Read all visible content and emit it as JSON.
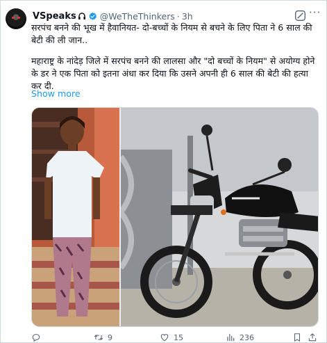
{
  "tweet": {
    "display_name": "VSpeaks",
    "handle": "@WeTheThinkers",
    "separator": "·",
    "time": "3h",
    "text_line1": "सरपंच बनने की भूख में हैवानियत- दो-बच्चों के नियम से बचने के लिए पिता ने 6 साल की बेटी की ली जान..",
    "text_line2": "महाराष्ट्र के नांदेड़ जिले में सरपंच बनने की लालसा और \"दो बच्चों के नियम\" से अयोग्य होने के डर ने एक पिता को इतना अंधा कर दिया कि उसने अपनी ही 6 साल की बेटी की हत्या कर दी.",
    "show_more": "Show more",
    "verified_color": "#1d9bf0",
    "link_color": "#1d9bf0"
  },
  "header_icons": [
    "headphones-icon",
    "verified-badge-icon",
    "grok-icon",
    "more-icon"
  ],
  "media": [
    {
      "description_name": "girl-photo"
    },
    {
      "description_name": "motorcycle-photo"
    }
  ],
  "actions": {
    "reply_count": "",
    "retweet_count": "9",
    "like_count": "15",
    "views_count": "236"
  }
}
